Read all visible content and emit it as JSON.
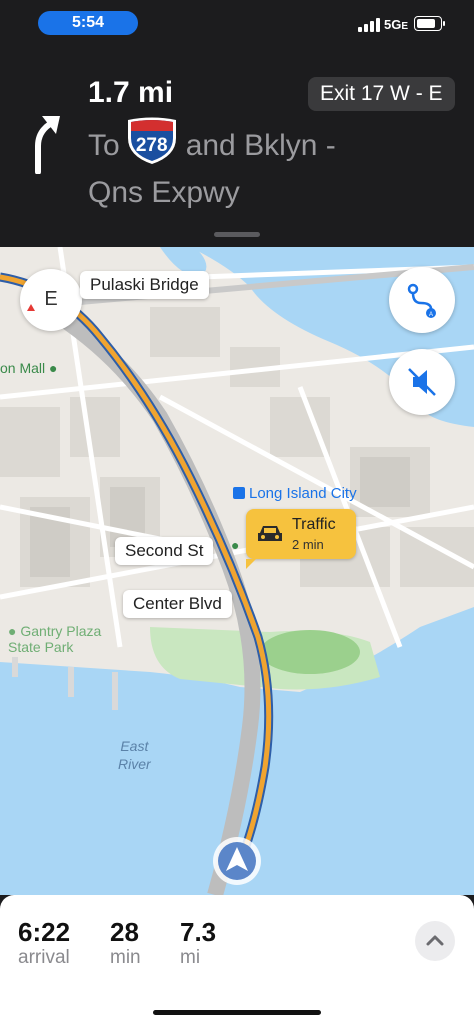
{
  "status_bar": {
    "time": "5:54",
    "network": "5G",
    "network_suffix": "E"
  },
  "guidance": {
    "distance": "1.7 mi",
    "exit": "Exit 17 W - E",
    "prefix": "To",
    "route_shield": "278",
    "suffix": "and Bklyn -",
    "line2": "Qns Expwy",
    "maneuver_icon": "turn-slight-left-arrow"
  },
  "map": {
    "compass_heading": "E",
    "labels": {
      "pulaski_bridge": "Pulaski Bridge",
      "second_st": "Second St",
      "center_blvd": "Center Blvd",
      "mall": "on Mall",
      "long_island_city": "Long Island City",
      "gantry_line1": "Gantry Plaza",
      "gantry_line2": "State Park",
      "east_line1": "East",
      "east_line2": "River"
    },
    "traffic": {
      "title": "Traffic",
      "delay": "2 min"
    },
    "buttons": {
      "route_overview_icon": "route-overview-icon",
      "mute_icon": "speaker-muted-icon"
    }
  },
  "trip": {
    "arrival_value": "6:22",
    "arrival_label": "arrival",
    "duration_value": "28",
    "duration_label": "min",
    "distance_value": "7.3",
    "distance_label": "mi"
  },
  "colors": {
    "accent": "#1a73e8",
    "route": "#f0a430",
    "traffic": "#f6c23e",
    "water": "#a9d6f5"
  }
}
